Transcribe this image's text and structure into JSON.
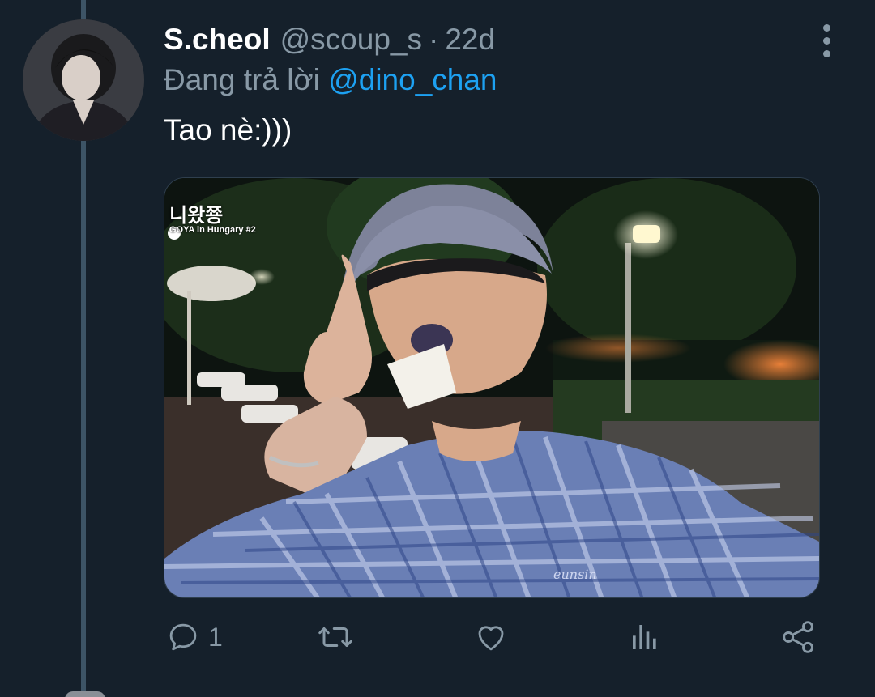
{
  "tweet": {
    "display_name": "S.cheol",
    "handle": "@scoup_s",
    "separator": "·",
    "time": "22d",
    "reply_prefix": "Đang trả lời ",
    "reply_to": "@dino_chan",
    "text": "Tao nè:)))"
  },
  "media": {
    "caption": "니왔쭁",
    "subcaption": "GOYA in Hungary #2",
    "watermark": "eunsin"
  },
  "actions": {
    "reply": {
      "icon": "reply-icon",
      "count": "1"
    },
    "retweet": {
      "icon": "retweet-icon",
      "count": ""
    },
    "like": {
      "icon": "heart-icon",
      "count": ""
    },
    "analytics": {
      "icon": "analytics-icon"
    },
    "share": {
      "icon": "share-icon"
    }
  },
  "colors": {
    "background": "#15202b",
    "secondary_text": "#8899a6",
    "link": "#1da1f2",
    "thread_line": "#3d5466"
  }
}
